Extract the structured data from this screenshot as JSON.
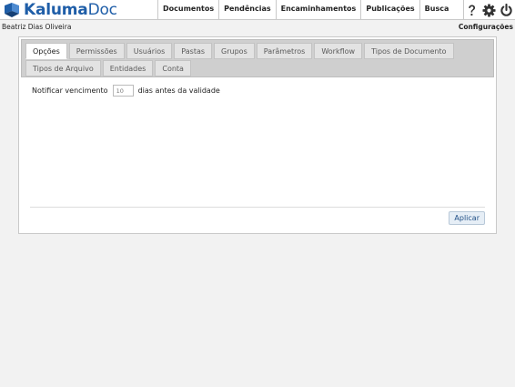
{
  "app": {
    "brand": "Kaluma",
    "product": "Doc"
  },
  "nav": {
    "items": [
      {
        "label": "Documentos"
      },
      {
        "label": "Pendências"
      },
      {
        "label": "Encaminhamentos"
      },
      {
        "label": "Publicações"
      },
      {
        "label": "Busca"
      }
    ]
  },
  "icons": {
    "help": "help-icon",
    "settings": "gear-icon",
    "logout": "power-icon"
  },
  "user": {
    "name": "Beatriz Dias Oliveira"
  },
  "settings_link": "Configurações",
  "tabs": {
    "row1": [
      {
        "label": "Opções",
        "active": true
      },
      {
        "label": "Permissões"
      },
      {
        "label": "Usuários"
      },
      {
        "label": "Pastas"
      },
      {
        "label": "Grupos"
      },
      {
        "label": "Parâmetros"
      },
      {
        "label": "Workflow"
      },
      {
        "label": "Tipos de Documento"
      }
    ],
    "row2": [
      {
        "label": "Tipos de Arquivo"
      },
      {
        "label": "Entidades"
      },
      {
        "label": "Conta"
      }
    ]
  },
  "form": {
    "label_before": "Notificar vencimento",
    "days_value": "10",
    "label_after": "dias antes da validade"
  },
  "apply_label": "Aplicar",
  "colors": {
    "brand": "#1f5ea8",
    "background": "#f2f2f2",
    "tabbar": "#cfcfcf"
  }
}
